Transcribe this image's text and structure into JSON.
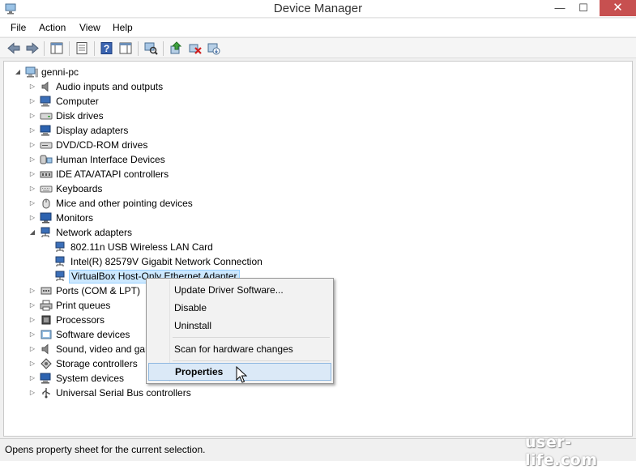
{
  "window": {
    "title": "Device Manager",
    "minimize_glyph": "—",
    "maximize_glyph": "☐",
    "close_glyph": "✕"
  },
  "menu": {
    "file": "File",
    "action": "Action",
    "view": "View",
    "help": "Help"
  },
  "toolbar": {
    "buttons": [
      "back-icon",
      "forward-icon",
      "show-hide-tree-icon",
      "properties-icon",
      "help-icon",
      "action-pane-icon",
      "scan-hardware-icon",
      "update-driver-icon",
      "uninstall-icon",
      "enable-device-icon"
    ]
  },
  "tree": {
    "root": "genni-pc",
    "categories": [
      {
        "label": "Audio inputs and outputs",
        "icon": "speaker-icon"
      },
      {
        "label": "Computer",
        "icon": "computer-icon"
      },
      {
        "label": "Disk drives",
        "icon": "disk-drive-icon"
      },
      {
        "label": "Display adapters",
        "icon": "display-adapter-icon"
      },
      {
        "label": "DVD/CD-ROM drives",
        "icon": "dvd-drive-icon"
      },
      {
        "label": "Human Interface Devices",
        "icon": "hid-icon"
      },
      {
        "label": "IDE ATA/ATAPI controllers",
        "icon": "ide-controller-icon"
      },
      {
        "label": "Keyboards",
        "icon": "keyboard-icon"
      },
      {
        "label": "Mice and other pointing devices",
        "icon": "mouse-icon"
      },
      {
        "label": "Monitors",
        "icon": "monitor-icon"
      },
      {
        "label": "Network adapters",
        "icon": "network-adapter-icon"
      }
    ],
    "network_children": [
      "802.11n USB Wireless LAN Card",
      "Intel(R) 82579V Gigabit Network Connection",
      "VirtualBox Host-Only Ethernet Adapter"
    ],
    "categories_after": [
      {
        "label": "Ports (COM & LPT)",
        "icon": "port-icon"
      },
      {
        "label": "Print queues",
        "icon": "printer-icon"
      },
      {
        "label": "Processors",
        "icon": "processor-icon"
      },
      {
        "label": "Software devices",
        "icon": "software-device-icon"
      },
      {
        "label": "Sound, video and gar",
        "icon": "sound-icon"
      },
      {
        "label": "Storage controllers",
        "icon": "storage-controller-icon"
      },
      {
        "label": "System devices",
        "icon": "system-device-icon"
      },
      {
        "label": "Universal Serial Bus controllers",
        "icon": "usb-icon"
      }
    ]
  },
  "context_menu": {
    "update_driver": "Update Driver Software...",
    "disable": "Disable",
    "uninstall": "Uninstall",
    "scan": "Scan for hardware changes",
    "properties": "Properties"
  },
  "status": {
    "text": "Opens property sheet for the current selection."
  },
  "watermark": "user-life.com",
  "colors": {
    "selection_bg": "#cce8ff",
    "selection_border": "#99d1ff",
    "close_button": "#c75050",
    "menu_highlight": "#dbe9f7"
  }
}
